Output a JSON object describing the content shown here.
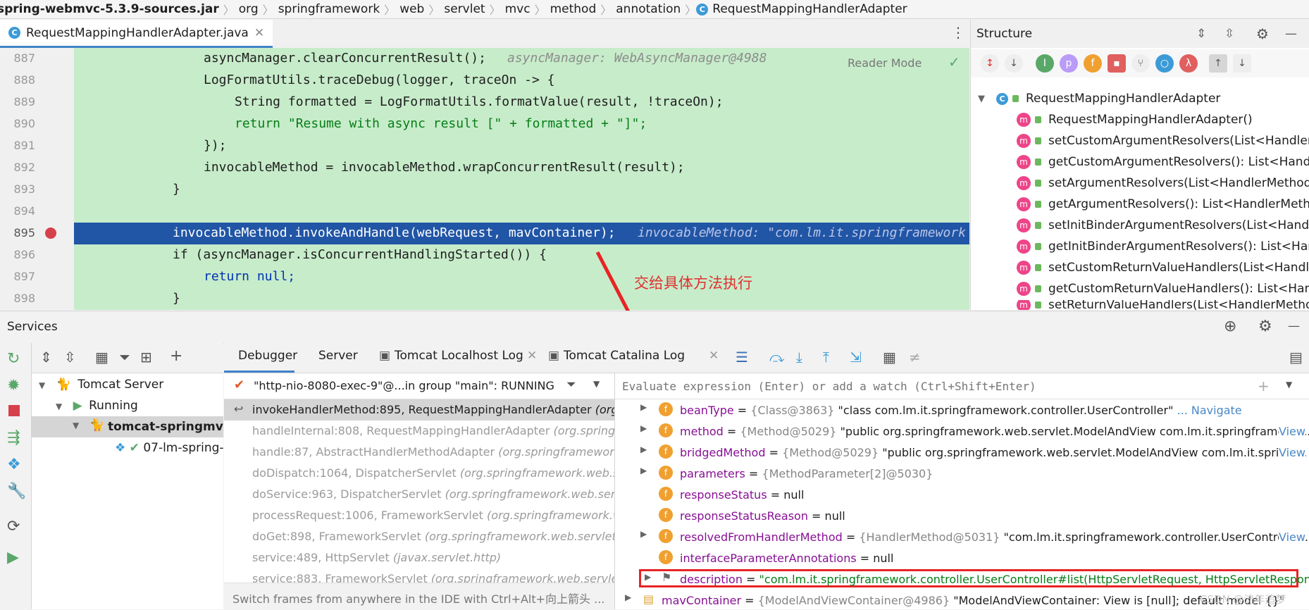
{
  "breadcrumb": [
    "spring-webmvc-5.3.9-sources.jar",
    "org",
    "springframework",
    "web",
    "servlet",
    "mvc",
    "method",
    "annotation",
    "RequestMappingHandlerAdapter"
  ],
  "editor": {
    "file_tab": "RequestMappingHandlerAdapter.java",
    "reader_mode": "Reader Mode",
    "lines": [
      {
        "n": "887",
        "code": "asyncManager.clearConcurrentResult();",
        "hint": "asyncManager: WebAsyncManager@4988"
      },
      {
        "n": "888",
        "code": "LogFormatUtils.traceDebug(logger, traceOn -> {",
        "hint": ""
      },
      {
        "n": "889",
        "code": "String formatted = LogFormatUtils.formatValue(result, !traceOn);",
        "hint": ""
      },
      {
        "n": "890",
        "code": "return \"Resume with async result [\" + formatted + \"]\";",
        "hint": ""
      },
      {
        "n": "891",
        "code": "});",
        "hint": ""
      },
      {
        "n": "892",
        "code": "invocableMethod = invocableMethod.wrapConcurrentResult(result);",
        "hint": ""
      },
      {
        "n": "893",
        "code": "}",
        "hint": ""
      },
      {
        "n": "894",
        "code": "",
        "hint": ""
      },
      {
        "n": "895",
        "code": "invocableMethod.invokeAndHandle(webRequest, mavContainer);",
        "hint": "invocableMethod: \"com.lm.it.springframework"
      },
      {
        "n": "896",
        "code": "if (asyncManager.isConcurrentHandlingStarted()) {",
        "hint": ""
      },
      {
        "n": "897",
        "code": "return null;",
        "hint": ""
      },
      {
        "n": "898",
        "code": "}",
        "hint": ""
      }
    ],
    "annotation": "交给具体方法执行"
  },
  "structure": {
    "title": "Structure",
    "root": "RequestMappingHandlerAdapter",
    "items": [
      "RequestMappingHandlerAdapter()",
      "setCustomArgumentResolvers(List<HandlerMet",
      "getCustomArgumentResolvers(): List<HandlerM",
      "setArgumentResolvers(List<HandlerMethodArgu",
      "getArgumentResolvers(): List<HandlerMethodAr",
      "setInitBinderArgumentResolvers(List<HandlerM",
      "getInitBinderArgumentResolvers(): List<Handler",
      "setCustomReturnValueHandlers(List<HandlerMe",
      "getCustomReturnValueHandlers(): List<Handler",
      "setReturnValueHandlers(List<HandlerMethodRe"
    ]
  },
  "services": {
    "title": "Services",
    "tree": {
      "server": "Tomcat Server",
      "state": "Running",
      "config": "tomcat-springmvc",
      "artifact": "07-lm-spring-"
    },
    "tabs": [
      "Debugger",
      "Server",
      "Tomcat Localhost Log",
      "Tomcat Catalina Log"
    ],
    "thread": "\"http-nio-8080-exec-9\"@...in group \"main\": RUNNING",
    "watch_placeholder": "Evaluate expression (Enter) or add a watch (Ctrl+Shift+Enter)",
    "frames": [
      {
        "m": "invokeHandlerMethod:895, RequestMappingHandlerAdapter",
        "c": "(org.sp"
      },
      {
        "m": "handleInternal:808, RequestMappingHandlerAdapter",
        "c": "(org.springfra"
      },
      {
        "m": "handle:87, AbstractHandlerMethodAdapter",
        "c": "(org.springframework.w"
      },
      {
        "m": "doDispatch:1064, DispatcherServlet",
        "c": "(org.springframework.web.servle"
      },
      {
        "m": "doService:963, DispatcherServlet",
        "c": "(org.springframework.web.servlet)"
      },
      {
        "m": "processRequest:1006, FrameworkServlet",
        "c": "(org.springframework.web."
      },
      {
        "m": "doGet:898, FrameworkServlet",
        "c": "(org.springframework.web.servlet)"
      },
      {
        "m": "service:489, HttpServlet",
        "c": "(javax.servlet.http)"
      },
      {
        "m": "service:883, FrameworkServlet",
        "c": "(org.springframework.web.servlet)"
      }
    ],
    "frames_hint": "Switch frames from anywhere in the IDE with Ctrl+Alt+向上箭头 ...",
    "variables": [
      {
        "name": "beanType",
        "ref": "{Class@3863}",
        "val": "\"class com.lm.it.springframework.controller.UserController\"",
        "link": "... Navigate",
        "expand": true
      },
      {
        "name": "method",
        "ref": "{Method@5029}",
        "val": "\"public org.springframework.web.servlet.ModelAndView com.lm.it.springframewc...",
        "link": "View",
        "expand": true
      },
      {
        "name": "bridgedMethod",
        "ref": "{Method@5029}",
        "val": "\"public org.springframework.web.servlet.ModelAndView com.lm.it.springf...",
        "link": "View",
        "expand": true
      },
      {
        "name": "parameters",
        "ref": "{MethodParameter[2]@5030}",
        "val": "",
        "link": "",
        "expand": true
      },
      {
        "name": "responseStatus",
        "ref": "",
        "val": "null",
        "link": "",
        "expand": false
      },
      {
        "name": "responseStatusReason",
        "ref": "",
        "val": "null",
        "link": "",
        "expand": false
      },
      {
        "name": "resolvedFromHandlerMethod",
        "ref": "{HandlerMethod@5031}",
        "val": "\"com.lm.it.springframework.controller.UserControlle...",
        "link": "View",
        "expand": true
      },
      {
        "name": "interfaceParameterAnnotations",
        "ref": "",
        "val": "null",
        "link": "",
        "expand": false
      },
      {
        "name": "description",
        "ref": "",
        "val": "\"com.lm.it.springframework.controller.UserController#list(HttpServletRequest, HttpServletResponse)\"",
        "link": "",
        "expand": true
      },
      {
        "name": "mavContainer",
        "ref": "{ModelAndViewContainer@4986}",
        "val": "\"ModelAndViewContainer: View is [null]; default model {}\"",
        "link": "",
        "expand": true
      }
    ],
    "watermark": "CSDN @流年追梦"
  }
}
